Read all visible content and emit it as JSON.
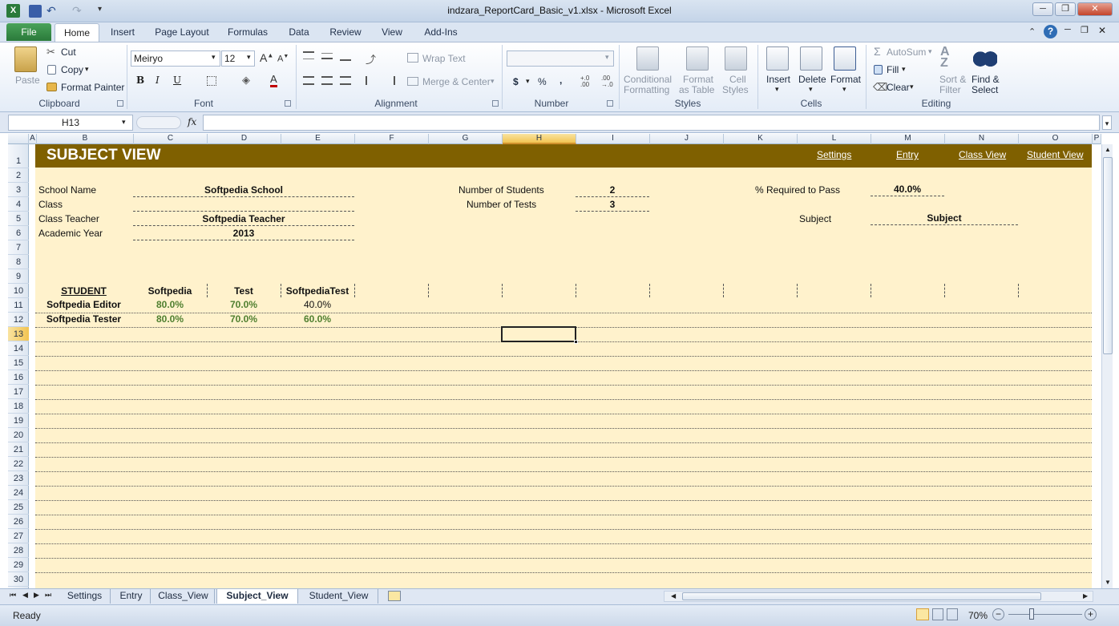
{
  "window": {
    "title": "indzara_ReportCard_Basic_v1.xlsx - Microsoft Excel",
    "controls": [
      "─",
      "❐",
      "✕"
    ]
  },
  "ribbon_tabs": [
    "File",
    "Home",
    "Insert",
    "Page Layout",
    "Formulas",
    "Data",
    "Review",
    "View",
    "Add-Ins"
  ],
  "ribbon": {
    "clipboard": {
      "paste": "Paste",
      "cut": "Cut",
      "copy": "Copy",
      "format_painter": "Format Painter",
      "group": "Clipboard"
    },
    "font": {
      "name": "Meiryo",
      "size": "12",
      "group": "Font"
    },
    "alignment": {
      "wrap": "Wrap Text",
      "merge": "Merge & Center",
      "group": "Alignment"
    },
    "number": {
      "currency": "$",
      "percent": "%",
      "comma": ",",
      "group": "Number"
    },
    "styles": {
      "conditional_1": "Conditional",
      "conditional_2": "Formatting",
      "table_1": "Format",
      "table_2": "as Table",
      "cell_1": "Cell",
      "cell_2": "Styles",
      "group": "Styles"
    },
    "cells": {
      "insert": "Insert",
      "delete": "Delete",
      "format": "Format",
      "group": "Cells"
    },
    "editing": {
      "autosum": "AutoSum",
      "fill": "Fill",
      "clear": "Clear",
      "sort_1": "Sort &",
      "sort_2": "Filter",
      "find_1": "Find &",
      "find_2": "Select",
      "group": "Editing"
    }
  },
  "formula_bar": {
    "name_box": "H13",
    "fx": "fx",
    "formula": ""
  },
  "columns": [
    "A",
    "B",
    "C",
    "D",
    "E",
    "F",
    "G",
    "H",
    "I",
    "J",
    "K",
    "L",
    "M",
    "N",
    "O",
    "P"
  ],
  "rows": [
    "1",
    "2",
    "3",
    "4",
    "5",
    "6",
    "7",
    "8",
    "9",
    "10",
    "11",
    "12",
    "13",
    "14",
    "15",
    "16",
    "17",
    "18",
    "19",
    "20",
    "21",
    "22",
    "23",
    "24",
    "25",
    "26",
    "27",
    "28",
    "29",
    "30"
  ],
  "sheet": {
    "banner_title": "SUBJECT VIEW",
    "nav_links": [
      "Settings",
      "Entry",
      "Class View",
      "Student View"
    ],
    "school_name_label": "School Name",
    "school_name": "Softpedia School",
    "class_label": "Class",
    "class_value": "",
    "class_teacher_label": "Class Teacher",
    "class_teacher": "Softpedia Teacher",
    "academic_year_label": "Academic Year",
    "academic_year": "2013",
    "num_students_label": "Number of Students",
    "num_students": "2",
    "num_tests_label": "Number of Tests",
    "num_tests": "3",
    "pass_label": "% Required to Pass",
    "pass_value": "40.0%",
    "subject_label": "Subject",
    "subject_value": "Subject",
    "table_headers": [
      "STUDENT",
      "Softpedia",
      "Test",
      "SoftpediaTest"
    ],
    "students": [
      {
        "name": "Softpedia Editor",
        "scores": [
          "80.0%",
          "70.0%",
          "40.0%"
        ]
      },
      {
        "name": "Softpedia Tester",
        "scores": [
          "80.0%",
          "70.0%",
          "60.0%"
        ]
      }
    ]
  },
  "sheet_tabs": [
    "Settings",
    "Entry",
    "Class_View",
    "Subject_View",
    "Student_View"
  ],
  "active_sheet": "Subject_View",
  "status": {
    "ready": "Ready",
    "zoom": "70%"
  },
  "colors": {
    "banner": "#7f6000",
    "sheet_bg": "#fff2cc",
    "good_score": "#4f7f2f"
  }
}
